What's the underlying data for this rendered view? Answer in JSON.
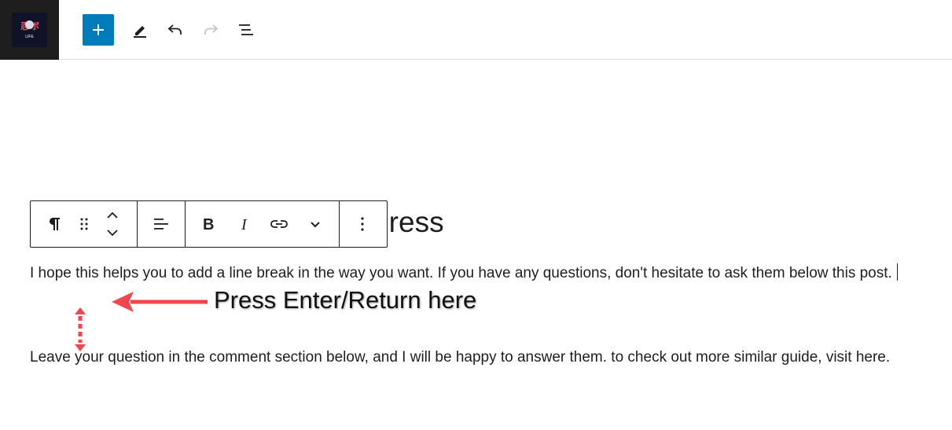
{
  "site_logo": {
    "glyphs": "忍 ボ",
    "sub": "LIFE"
  },
  "toolbar": {
    "add_block_label": "Add block",
    "tools_label": "Tools",
    "undo_label": "Undo",
    "redo_label": "Redo",
    "document_overview_label": "Document Overview"
  },
  "editor": {
    "heading_visible_part": "Press",
    "paragraph_1": "I hope this helps you to add a line break in the way you want. If you have any questions, don't hesitate to ask them below this post.",
    "paragraph_2": "Leave your question in the comment section below, and I will be happy to answer them. to check out more similar guide, visit here."
  },
  "block_toolbar": {
    "items": [
      "paragraph-icon",
      "drag-handle-icon",
      "move-up-down-icon",
      "align-icon",
      "bold-icon",
      "italic-icon",
      "link-icon",
      "more-rich-text-chevron-icon",
      "options-ellipsis-icon"
    ]
  },
  "annotation": {
    "text": "Press Enter/Return here",
    "color": "#f0474f"
  },
  "colors": {
    "accent": "#007cba",
    "text": "#1e1e1e",
    "sidebar_dark": "#1e1e1e"
  }
}
